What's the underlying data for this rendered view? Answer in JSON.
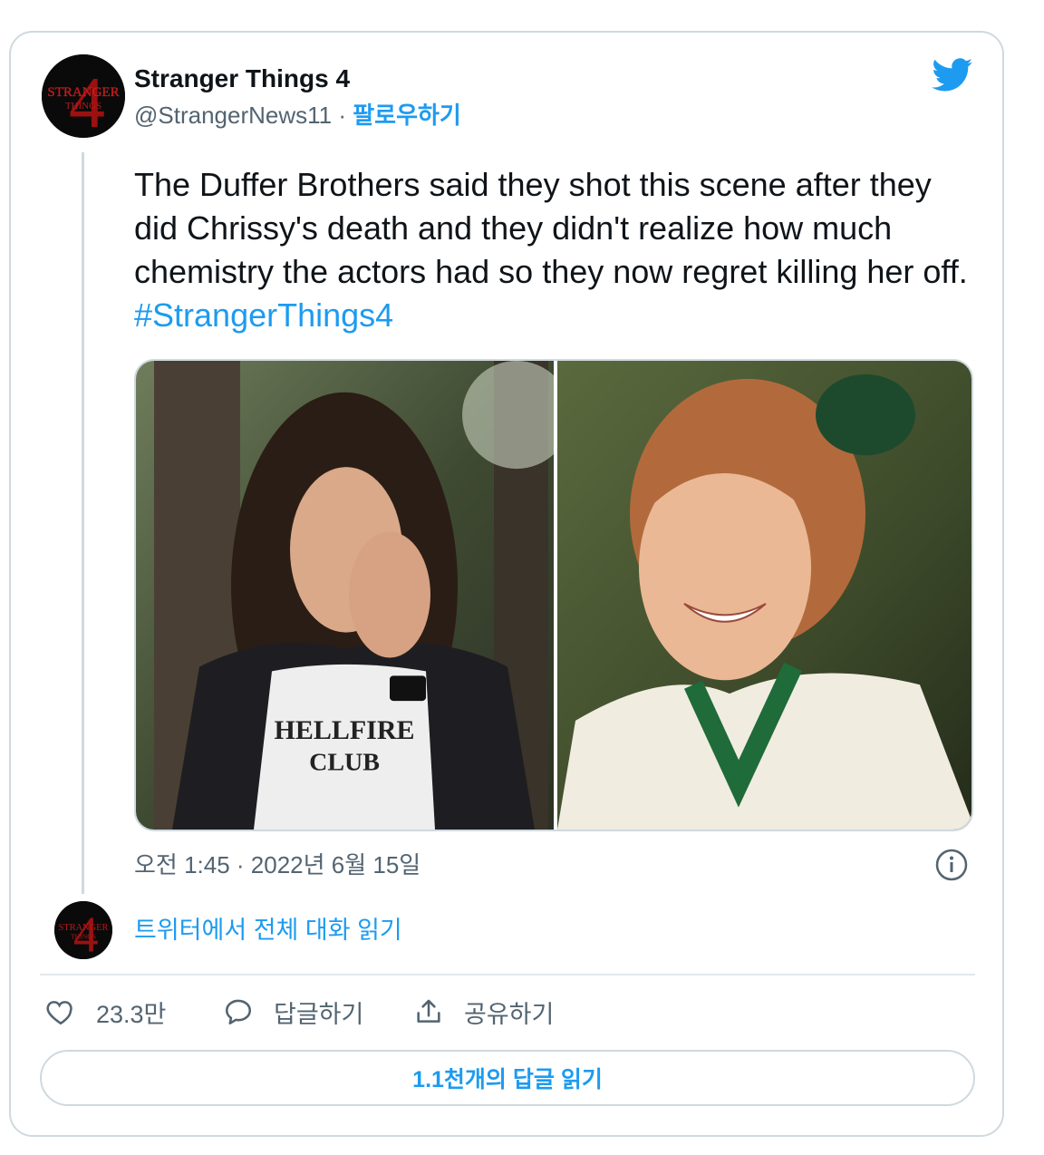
{
  "tweet": {
    "display_name": "Stranger Things 4",
    "handle": "@StrangerNews11",
    "separator": " · ",
    "follow_label": "팔로우하기",
    "body_text": "The Duffer Brothers said they shot this scene after they did Chrissy's death and they didn't realize how much chemistry the actors had so they now regret killing her off. ",
    "hashtag": "#StrangerThings4",
    "timestamp": "오전 1:45 · 2022년 6월 15일",
    "avatar_logo_text_line1": "STRANGER",
    "avatar_logo_text_line2": "THINGS",
    "avatar_logo_numeral": "4"
  },
  "media": {
    "left_photo_shirt_text_1": "HELLFIRE",
    "left_photo_shirt_text_2": "CLUB"
  },
  "conversation": {
    "link_label": "트위터에서 전체 대화 읽기"
  },
  "actions": {
    "like_count": "23.3만",
    "reply_label": "답글하기",
    "share_label": "공유하기"
  },
  "footer": {
    "read_replies_label": "1.1천개의 답글 읽기"
  },
  "colors": {
    "accent": "#1d9bf0",
    "secondary_text": "#536471",
    "border": "#cfd9de"
  },
  "icons": [
    "twitter-bird-icon",
    "info-icon",
    "heart-icon",
    "reply-icon",
    "share-icon"
  ]
}
